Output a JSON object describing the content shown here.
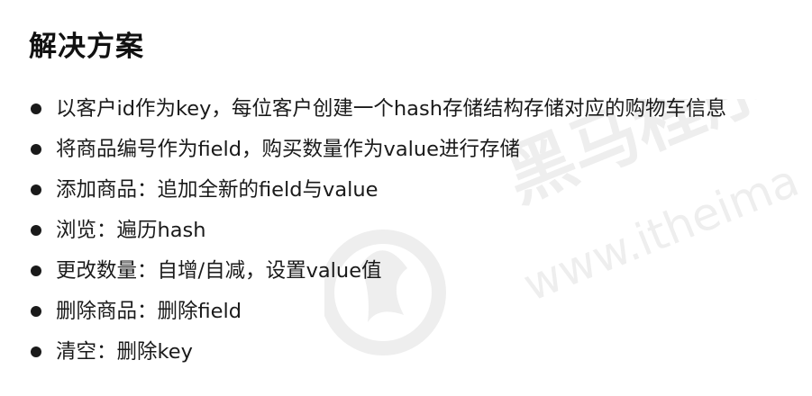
{
  "heading": "解决方案",
  "bullets": [
    "以客户id作为key，每位客户创建一个hash存储结构存储对应的购物车信息",
    "将商品编号作为field，购买数量作为value进行存储",
    "添加商品：追加全新的field与value",
    "浏览：遍历hash",
    "更改数量：自增/自减，设置value值",
    "删除商品：删除field",
    "清空：删除key"
  ],
  "watermark": {
    "brand_text": "黑马程序",
    "url_text": "www.itheima"
  }
}
